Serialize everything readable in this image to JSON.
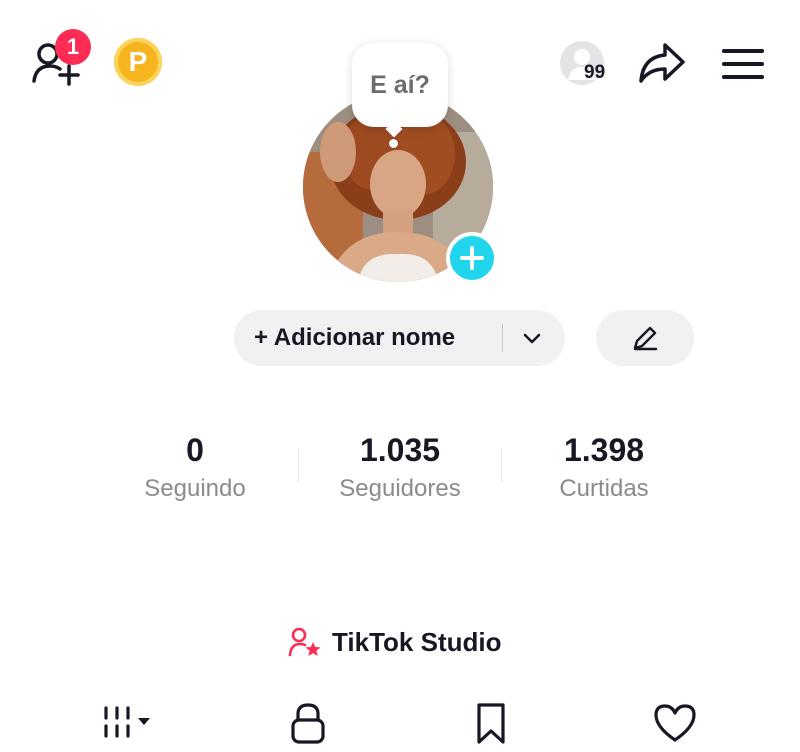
{
  "header": {
    "add_friends_badge": "1",
    "coin_letter": "P",
    "profile_views_count": "99"
  },
  "avatar": {
    "speech_bubble": "E aí?"
  },
  "profile": {
    "add_name_label": "+ Adicionar nome"
  },
  "stats": [
    {
      "value": "0",
      "label": "Seguindo"
    },
    {
      "value": "1.035",
      "label": "Seguidores"
    },
    {
      "value": "1.398",
      "label": "Curtidas"
    }
  ],
  "studio": {
    "label": "TikTok Studio"
  },
  "tabs": [
    {
      "icon": "grid-videos-icon"
    },
    {
      "icon": "lock-icon"
    },
    {
      "icon": "bookmark-icon"
    },
    {
      "icon": "heart-icon"
    }
  ],
  "colors": {
    "accent_red": "#fe2c55",
    "plus_cyan": "#20d5ec",
    "coin_gold": "#f6b51e",
    "pill_bg": "#f1f1f2"
  }
}
